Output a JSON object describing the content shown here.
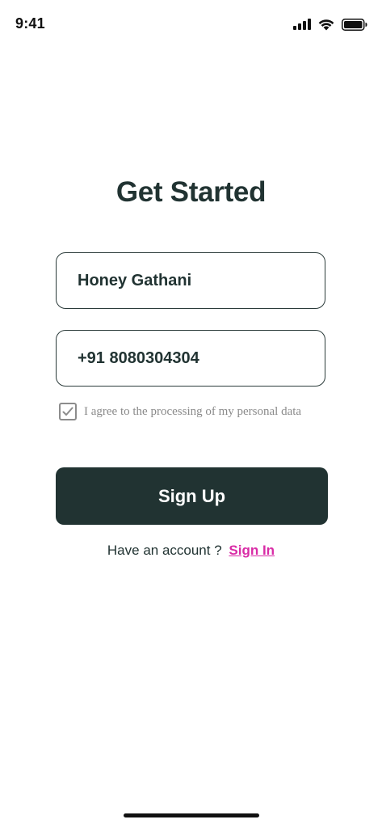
{
  "status_bar": {
    "time": "9:41",
    "icons": [
      "signal-icon",
      "wifi-icon",
      "battery-icon"
    ]
  },
  "title": "Get Started",
  "form": {
    "name_value": "Honey Gathani",
    "phone_value": "+91 8080304304",
    "consent_label": "I agree to the processing of my personal data",
    "consent_checked": true
  },
  "buttons": {
    "signup_label": "Sign Up"
  },
  "signin": {
    "prompt": "Have an account ?",
    "link_label": "Sign In"
  },
  "colors": {
    "primary": "#213332",
    "link": "#d92ba6",
    "muted": "#8a8a8a",
    "background": "#ffffff"
  }
}
